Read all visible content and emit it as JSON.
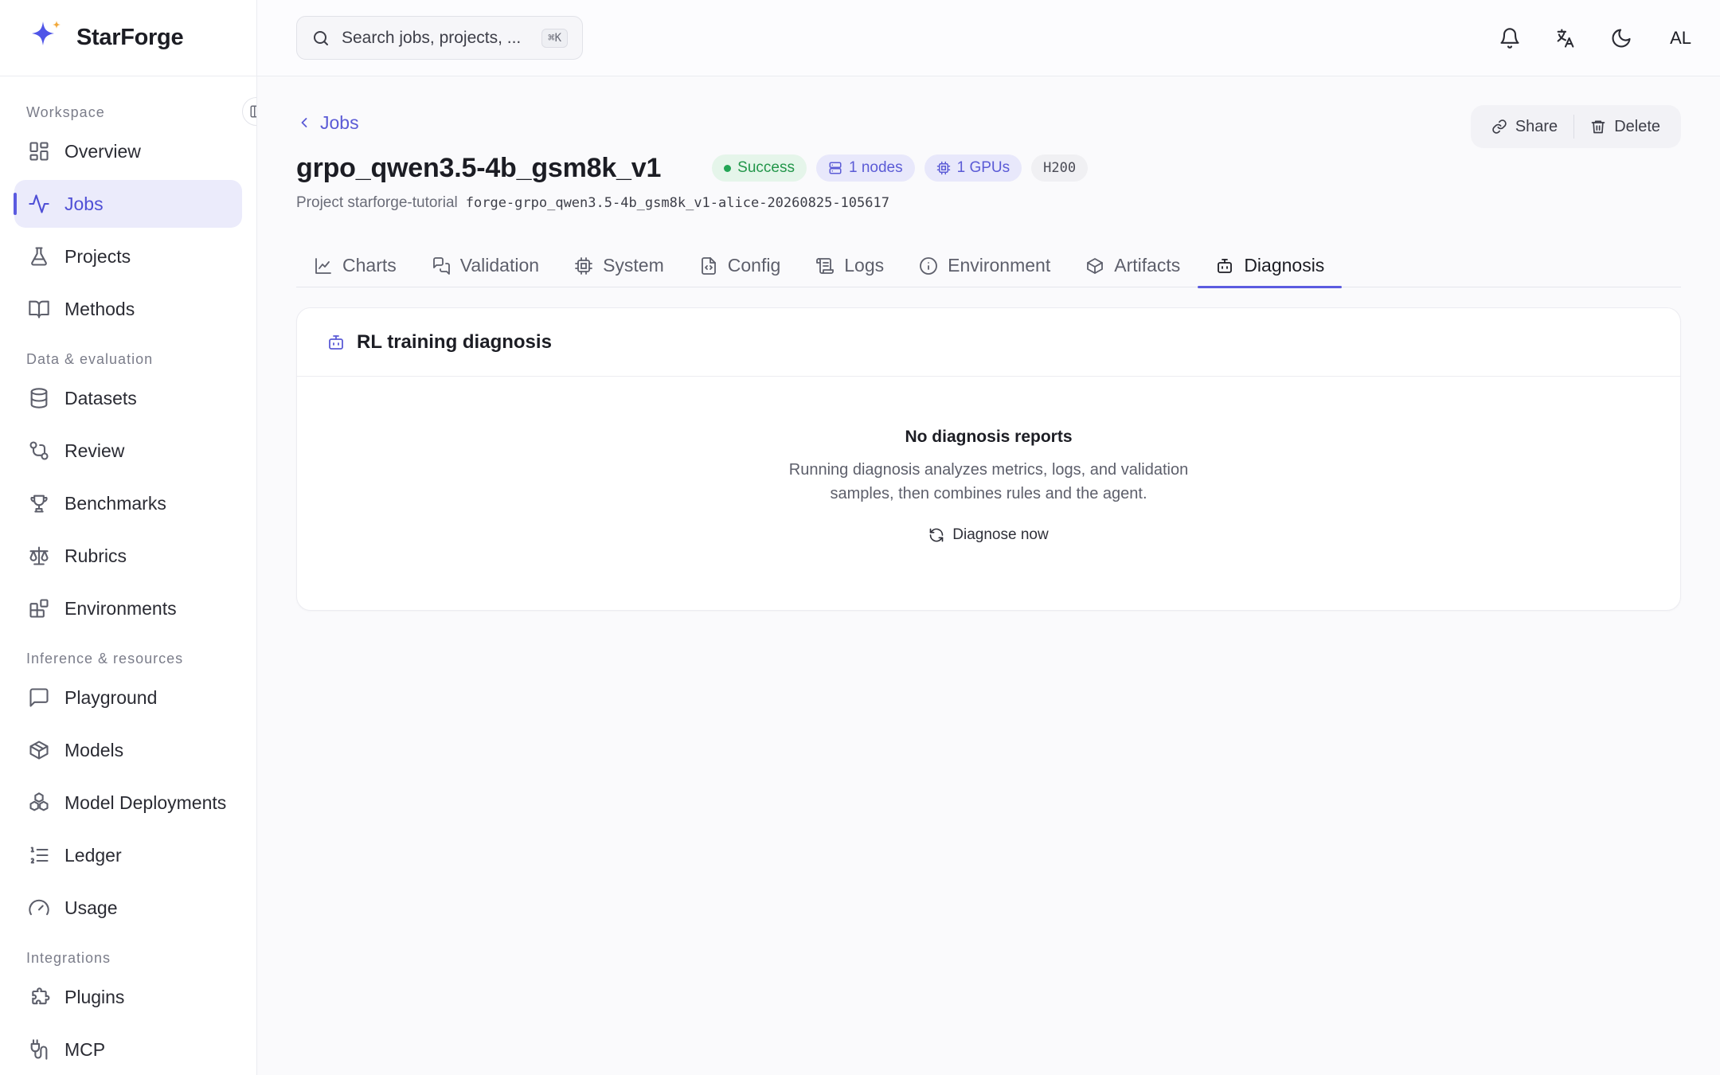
{
  "brand": {
    "name": "StarForge"
  },
  "sidebar": {
    "sections": [
      {
        "label": "Workspace",
        "items": [
          {
            "label": "Overview",
            "icon": "grid-icon"
          },
          {
            "label": "Jobs",
            "icon": "activity-icon",
            "active": true
          },
          {
            "label": "Projects",
            "icon": "flask-icon"
          },
          {
            "label": "Methods",
            "icon": "book-icon"
          }
        ]
      },
      {
        "label": "Data & evaluation",
        "items": [
          {
            "label": "Datasets",
            "icon": "database-icon"
          },
          {
            "label": "Review",
            "icon": "git-compare-icon"
          },
          {
            "label": "Benchmarks",
            "icon": "trophy-icon"
          },
          {
            "label": "Rubrics",
            "icon": "scale-icon"
          },
          {
            "label": "Environments",
            "icon": "blocks-icon"
          }
        ]
      },
      {
        "label": "Inference & resources",
        "items": [
          {
            "label": "Playground",
            "icon": "message-square-icon"
          },
          {
            "label": "Models",
            "icon": "box-icon"
          },
          {
            "label": "Model Deployments",
            "icon": "boxes-icon"
          },
          {
            "label": "Ledger",
            "icon": "list-ordered-icon"
          },
          {
            "label": "Usage",
            "icon": "gauge-icon"
          }
        ]
      },
      {
        "label": "Integrations",
        "items": [
          {
            "label": "Plugins",
            "icon": "puzzle-icon"
          },
          {
            "label": "MCP",
            "icon": "plug-icon"
          }
        ]
      }
    ]
  },
  "topbar": {
    "search_placeholder": "Search jobs, projects, ...",
    "shortcut": "⌘K",
    "avatar_initials": "AL"
  },
  "job": {
    "back_label": "Jobs",
    "title": "grpo_qwen3.5-4b_gsm8k_v1",
    "status": "Success",
    "nodes": "1 nodes",
    "gpus": "1 GPUs",
    "gpu_type": "H200",
    "project_label": "Project starforge-tutorial",
    "job_id": "forge-grpo_qwen3.5-4b_gsm8k_v1-alice-20260825-105617",
    "share_label": "Share",
    "delete_label": "Delete"
  },
  "tabs": [
    {
      "label": "Charts",
      "icon": "line-chart-icon"
    },
    {
      "label": "Validation",
      "icon": "messages-icon"
    },
    {
      "label": "System",
      "icon": "cpu-icon"
    },
    {
      "label": "Config",
      "icon": "file-code-icon"
    },
    {
      "label": "Logs",
      "icon": "scroll-icon"
    },
    {
      "label": "Environment",
      "icon": "info-icon"
    },
    {
      "label": "Artifacts",
      "icon": "package-icon"
    },
    {
      "label": "Diagnosis",
      "icon": "bot-icon",
      "active": true
    }
  ],
  "diagnosis": {
    "card_title": "RL training diagnosis",
    "empty_title": "No diagnosis reports",
    "empty_desc": "Running diagnosis analyzes metrics, logs, and validation samples, then combines rules and the agent.",
    "action_label": "Diagnose now"
  },
  "colors": {
    "accent": "#5b5be0",
    "success": "#23964a",
    "active_nav_bg": "#ebebfb"
  }
}
